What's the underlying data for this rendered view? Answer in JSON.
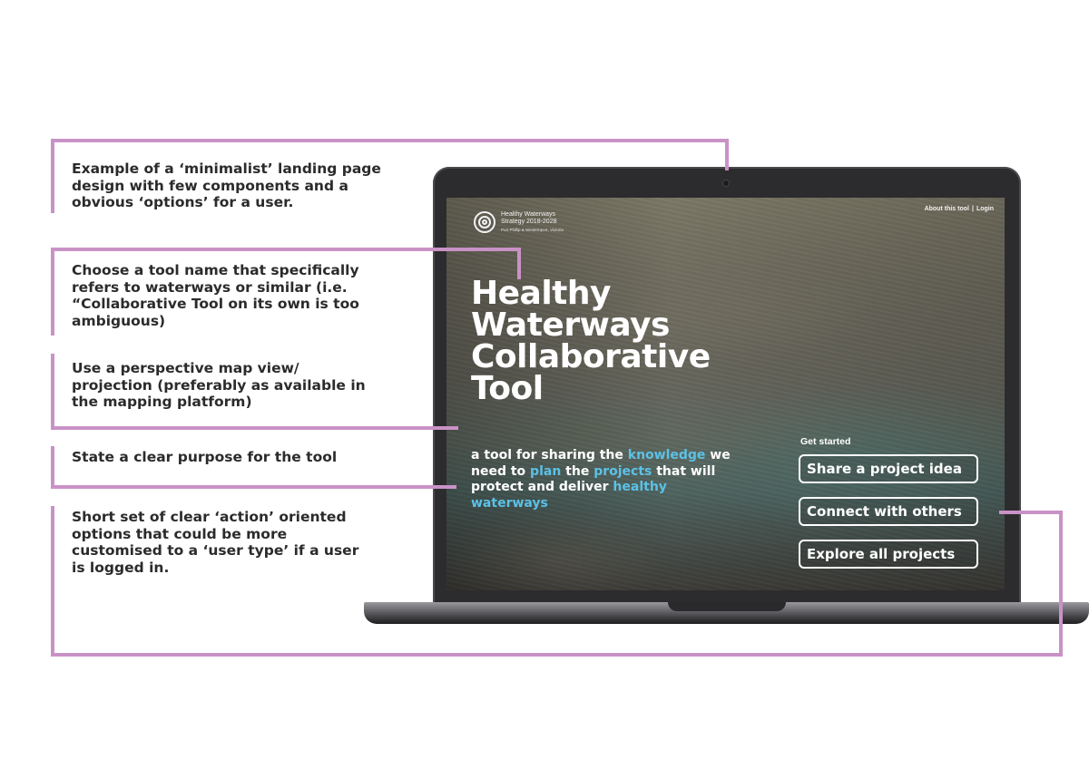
{
  "annotations": [
    {
      "text": "Example of a ‘minimalist’ landing page design with few components and a obvious ‘options’ for a user."
    },
    {
      "text": "Choose a tool name that specifically refers to waterways or similar (i.e. “Collaborative Tool on its own is too ambiguous)"
    },
    {
      "text": "Use a perspective map view/ projection (preferably as available in the mapping platform)"
    },
    {
      "text": "State a clear purpose for the tool"
    },
    {
      "text": "Short set of clear ‘action’ oriented options that could be more customised to a ‘user type’ if a user is logged in."
    }
  ],
  "annotation_line_color": "#c992c7",
  "screen": {
    "logo": {
      "line1": "Healthy Waterways",
      "line2": "Strategy 2018-2028",
      "tagline": "Port Phillip & Westernport, Victoria"
    },
    "nav": {
      "about": "About this tool",
      "separator": "|",
      "login": "Login"
    },
    "title_lines": [
      "Healthy",
      "Waterways",
      "Collaborative",
      "Tool"
    ],
    "subtitle": {
      "p1": "a tool for sharing the ",
      "k1": "knowledge",
      "p2": " we need to ",
      "k2": "plan",
      "p3": " the ",
      "k3": "projects",
      "p4": " that will protect and deliver ",
      "k4": "healthy waterways"
    },
    "highlight_color": "#5cc1e6",
    "get_started_label": "Get started",
    "buttons": {
      "share": "Share a project idea",
      "connect": "Connect with others",
      "explore": "Explore all projects"
    }
  }
}
